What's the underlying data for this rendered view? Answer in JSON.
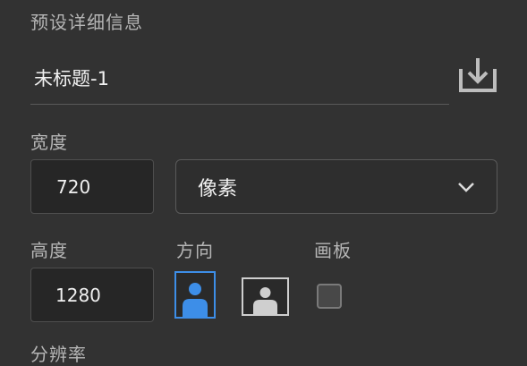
{
  "panel": {
    "section_title": "预设详细信息",
    "document_name": "未标题-1",
    "width_label": "宽度",
    "width_value": "720",
    "unit_selected": "像素",
    "height_label": "高度",
    "height_value": "1280",
    "orientation_label": "方向",
    "artboard_label": "画板",
    "resolution_label": "分辨率"
  },
  "state": {
    "orientation": "portrait",
    "artboard_checked": false
  },
  "colors": {
    "background": "#323232",
    "accent": "#3d8ee8",
    "field_bg": "#262626"
  },
  "icons": {
    "save": "save-preset-icon",
    "unit_dropdown": "chevron-down-icon",
    "portrait": "portrait-icon",
    "landscape": "landscape-icon"
  }
}
